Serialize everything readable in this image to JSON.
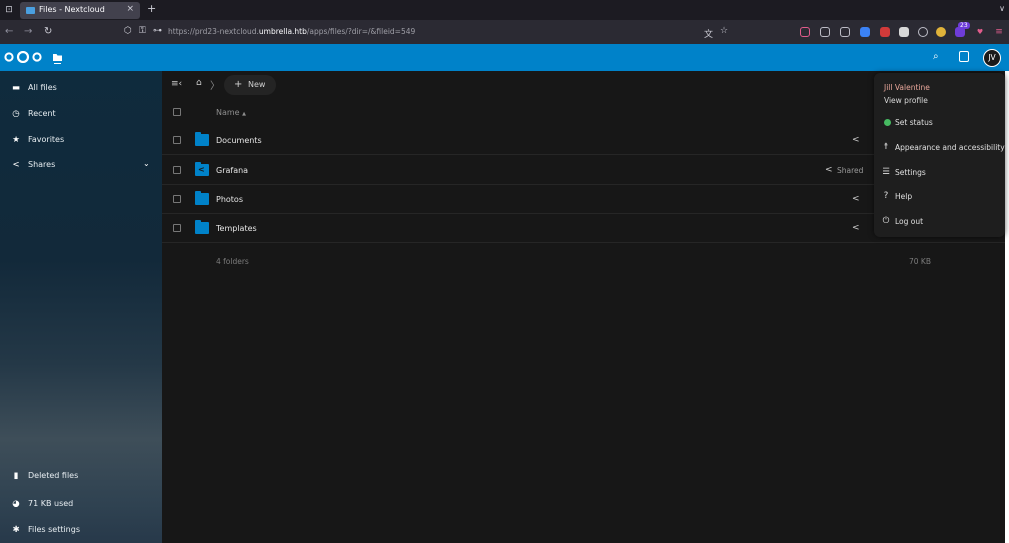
{
  "browser": {
    "tab_title": "Files - Nextcloud",
    "tab_close": "×",
    "new_tab": "+",
    "url_prefix": "https://prd23-nextcloud.",
    "url_domain": "umbrella.htb",
    "url_suffix": "/apps/files/?dir=/&fileid=549",
    "extension_badge": "23"
  },
  "sidebar": {
    "items": [
      {
        "label": "All files",
        "icon": "folder-icon"
      },
      {
        "label": "Recent",
        "icon": "clock-icon"
      },
      {
        "label": "Favorites",
        "icon": "star-icon"
      },
      {
        "label": "Shares",
        "icon": "share-icon"
      }
    ],
    "bottom": [
      {
        "label": "Deleted files",
        "icon": "trash-icon"
      },
      {
        "label": "71 KB used",
        "icon": "pie-chart-icon"
      },
      {
        "label": "Files settings",
        "icon": "gear-icon"
      }
    ]
  },
  "files": {
    "new_label": "New",
    "name_header": "Name",
    "sort_glyph": "▲",
    "rows": [
      {
        "name": "Documents",
        "shared": false
      },
      {
        "name": "Grafana",
        "shared": true,
        "shared_label": "Shared"
      },
      {
        "name": "Photos",
        "shared": false
      },
      {
        "name": "Templates",
        "shared": false
      }
    ],
    "summary": "4 folders",
    "total_size": "70 KB"
  },
  "user_menu": {
    "avatar_initials": "JV",
    "name": "Jill Valentine",
    "view_profile": "View profile",
    "items": [
      {
        "label": "Set status",
        "icon": "status-dot-icon"
      },
      {
        "label": "Appearance and accessibility",
        "icon": "accessibility-icon"
      },
      {
        "label": "Settings",
        "icon": "settings-sliders-icon"
      },
      {
        "label": "Help",
        "icon": "help-icon"
      },
      {
        "label": "Log out",
        "icon": "power-icon"
      }
    ]
  },
  "colors": {
    "accent": "#0082c9",
    "status_online": "#46ba61",
    "user_name": "#e9a79b"
  }
}
